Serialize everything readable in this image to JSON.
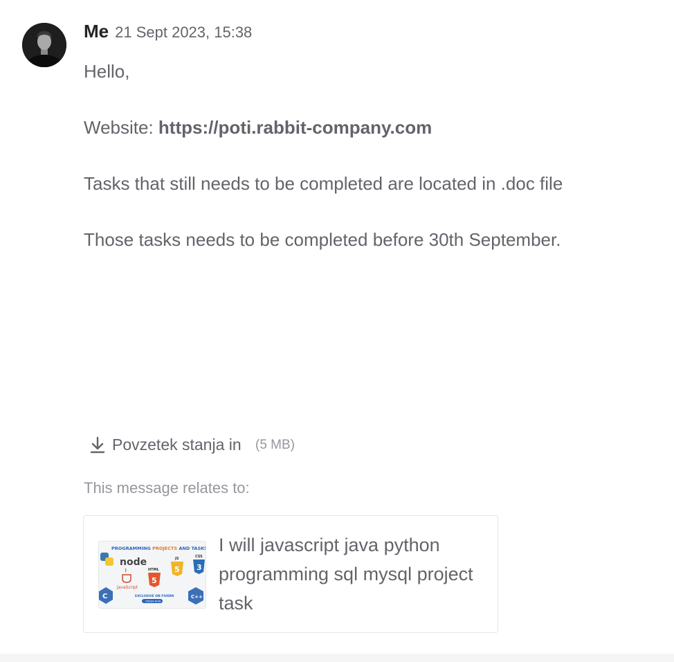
{
  "message": {
    "sender": "Me",
    "timestamp": "21 Sept 2023, 15:38",
    "greeting": "Hello,",
    "website_label": "Website: ",
    "website_url": "https://poti.rabbit-company.com",
    "line_tasks": "Tasks that still needs to be completed are located in .doc file",
    "line_deadline": "Those tasks needs to be completed before 30th September."
  },
  "attachment": {
    "icon": "download-icon",
    "name": "Povzetek stanja in",
    "size": "(5 MB)"
  },
  "relates": {
    "label": "This message relates to:"
  },
  "gig": {
    "title": "I will javascript java python programming sql mysql project task",
    "thumbnail": {
      "heading_part1": "PROGRAMMING",
      "heading_part2": "PROJECTS",
      "heading_part3": "AND TASKS",
      "node_label": "node",
      "html_label": "HTML",
      "js_label": "JS",
      "css_label": "CSS",
      "javascript_label": "JavaScript",
      "exclusive_label": "EXCLUSIVE ON FIVERR",
      "order_label": "ORDER NOW",
      "html_number": "5",
      "js_number": "5",
      "css_number": "3",
      "c_label": "C",
      "cpp_label": "C++"
    }
  },
  "colors": {
    "text": "#62646a",
    "muted": "#95979d",
    "dark": "#222325",
    "border": "#e4e5e7"
  }
}
